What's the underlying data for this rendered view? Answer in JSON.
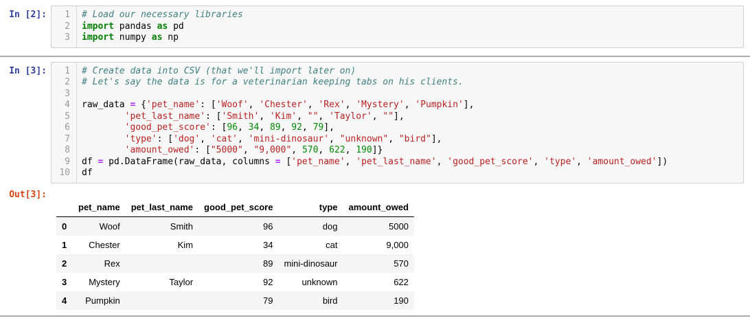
{
  "colors": {
    "in_prompt": "#303F9F",
    "out_prompt": "#D84315",
    "comment": "#408080",
    "keyword": "#008000",
    "string": "#BA2121",
    "number": "#008800",
    "operator": "#AA22FF",
    "cell_background": "#f7f7f7",
    "cell_border": "#cfcfcf",
    "table_stripe": "#f5f5f5",
    "divider": "#ababab"
  },
  "cells": [
    {
      "type": "code",
      "prompt": "In [2]:",
      "source_lines": [
        [
          [
            "com",
            "# Load our necessary libraries"
          ]
        ],
        [
          [
            "kw",
            "import"
          ],
          [
            "txt",
            " pandas "
          ],
          [
            "kw",
            "as"
          ],
          [
            "txt",
            " pd"
          ]
        ],
        [
          [
            "kw",
            "import"
          ],
          [
            "txt",
            " numpy "
          ],
          [
            "kw",
            "as"
          ],
          [
            "txt",
            " np"
          ]
        ]
      ]
    },
    {
      "type": "code",
      "prompt": "In [3]:",
      "source_lines": [
        [
          [
            "com",
            "# Create data into CSV (that we'll import later on)"
          ]
        ],
        [
          [
            "com",
            "# Let's say the data is for a veterinarian keeping tabs on his clients."
          ]
        ],
        [],
        [
          [
            "txt",
            "raw_data "
          ],
          [
            "op",
            "="
          ],
          [
            "txt",
            " {"
          ],
          [
            "str",
            "'pet_name'"
          ],
          [
            "txt",
            ": ["
          ],
          [
            "str",
            "'Woof'"
          ],
          [
            "txt",
            ", "
          ],
          [
            "str",
            "'Chester'"
          ],
          [
            "txt",
            ", "
          ],
          [
            "str",
            "'Rex'"
          ],
          [
            "txt",
            ", "
          ],
          [
            "str",
            "'Mystery'"
          ],
          [
            "txt",
            ", "
          ],
          [
            "str",
            "'Pumpkin'"
          ],
          [
            "txt",
            "],"
          ]
        ],
        [
          [
            "txt",
            "        "
          ],
          [
            "str",
            "'pet_last_name'"
          ],
          [
            "txt",
            ": ["
          ],
          [
            "str",
            "'Smith'"
          ],
          [
            "txt",
            ", "
          ],
          [
            "str",
            "'Kim'"
          ],
          [
            "txt",
            ", "
          ],
          [
            "str",
            "\"\""
          ],
          [
            "txt",
            ", "
          ],
          [
            "str",
            "'Taylor'"
          ],
          [
            "txt",
            ", "
          ],
          [
            "str",
            "\"\""
          ],
          [
            "txt",
            "],"
          ]
        ],
        [
          [
            "txt",
            "        "
          ],
          [
            "str",
            "'good_pet_score'"
          ],
          [
            "txt",
            ": ["
          ],
          [
            "num",
            "96"
          ],
          [
            "txt",
            ", "
          ],
          [
            "num",
            "34"
          ],
          [
            "txt",
            ", "
          ],
          [
            "num",
            "89"
          ],
          [
            "txt",
            ", "
          ],
          [
            "num",
            "92"
          ],
          [
            "txt",
            ", "
          ],
          [
            "num",
            "79"
          ],
          [
            "txt",
            "],"
          ]
        ],
        [
          [
            "txt",
            "        "
          ],
          [
            "str",
            "'type'"
          ],
          [
            "txt",
            ": ["
          ],
          [
            "str",
            "'dog'"
          ],
          [
            "txt",
            ", "
          ],
          [
            "str",
            "'cat'"
          ],
          [
            "txt",
            ", "
          ],
          [
            "str",
            "'mini-dinosaur'"
          ],
          [
            "txt",
            ", "
          ],
          [
            "str",
            "\"unknown\""
          ],
          [
            "txt",
            ", "
          ],
          [
            "str",
            "\"bird\""
          ],
          [
            "txt",
            "],"
          ]
        ],
        [
          [
            "txt",
            "        "
          ],
          [
            "str",
            "'amount_owed'"
          ],
          [
            "txt",
            ": ["
          ],
          [
            "str",
            "\"5000\""
          ],
          [
            "txt",
            ", "
          ],
          [
            "str",
            "\"9,000\""
          ],
          [
            "txt",
            ", "
          ],
          [
            "num",
            "570"
          ],
          [
            "txt",
            ", "
          ],
          [
            "num",
            "622"
          ],
          [
            "txt",
            ", "
          ],
          [
            "num",
            "190"
          ],
          [
            "txt",
            "]}"
          ]
        ],
        [
          [
            "txt",
            "df "
          ],
          [
            "op",
            "="
          ],
          [
            "txt",
            " pd.DataFrame(raw_data, columns "
          ],
          [
            "op",
            "="
          ],
          [
            "txt",
            " ["
          ],
          [
            "str",
            "'pet_name'"
          ],
          [
            "txt",
            ", "
          ],
          [
            "str",
            "'pet_last_name'"
          ],
          [
            "txt",
            ", "
          ],
          [
            "str",
            "'good_pet_score'"
          ],
          [
            "txt",
            ", "
          ],
          [
            "str",
            "'type'"
          ],
          [
            "txt",
            ", "
          ],
          [
            "str",
            "'amount_owed'"
          ],
          [
            "txt",
            "])"
          ]
        ],
        [
          [
            "txt",
            "df"
          ]
        ]
      ],
      "output": {
        "prompt": "Out[3]:",
        "dataframe": {
          "columns": [
            "pet_name",
            "pet_last_name",
            "good_pet_score",
            "type",
            "amount_owed"
          ],
          "index": [
            "0",
            "1",
            "2",
            "3",
            "4"
          ],
          "rows": [
            [
              "Woof",
              "Smith",
              "96",
              "dog",
              "5000"
            ],
            [
              "Chester",
              "Kim",
              "34",
              "cat",
              "9,000"
            ],
            [
              "Rex",
              "",
              "89",
              "mini-dinosaur",
              "570"
            ],
            [
              "Mystery",
              "Taylor",
              "92",
              "unknown",
              "622"
            ],
            [
              "Pumpkin",
              "",
              "79",
              "bird",
              "190"
            ]
          ]
        }
      }
    }
  ]
}
